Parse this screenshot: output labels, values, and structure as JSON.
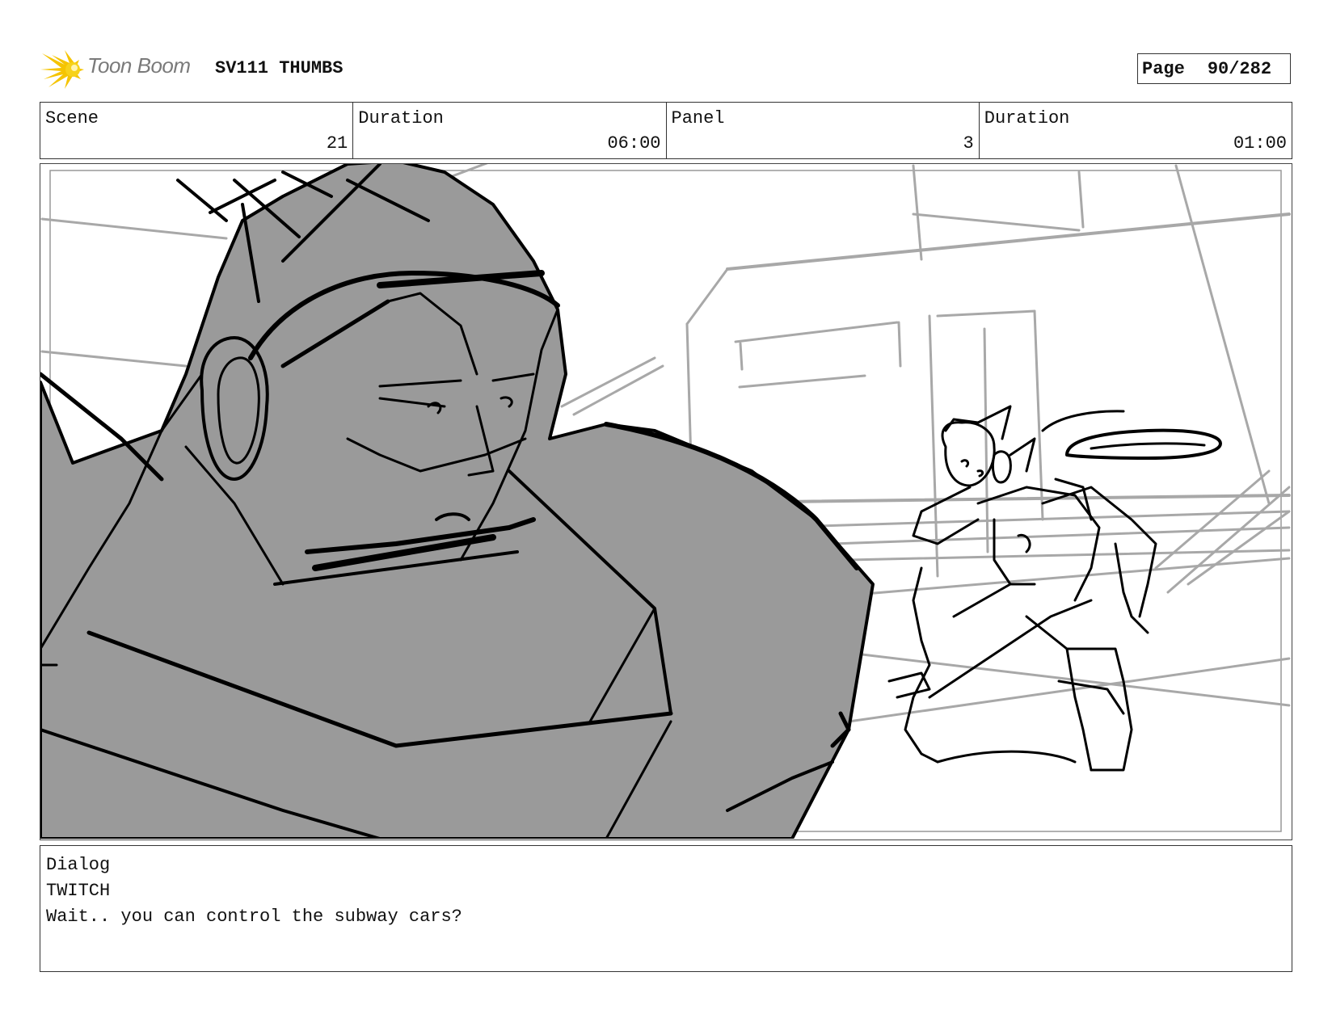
{
  "header": {
    "logo_text": "Toon Boom",
    "project_title": "SV111 THUMBS",
    "page_label": "Page",
    "page_value": "90/282"
  },
  "info": {
    "scene_label": "Scene",
    "scene_value": "21",
    "scene_duration_label": "Duration",
    "scene_duration_value": "06:00",
    "panel_label": "Panel",
    "panel_value": "3",
    "panel_duration_label": "Duration",
    "panel_duration_value": "01:00"
  },
  "dialog": {
    "label": "Dialog",
    "character": "TWITCH",
    "line": "Wait.. you can control the subway cars?"
  },
  "colors": {
    "logo_yellow": "#f5c400",
    "sketch_gray": "#9a9a9a",
    "line_gray": "#a8a8a8"
  }
}
